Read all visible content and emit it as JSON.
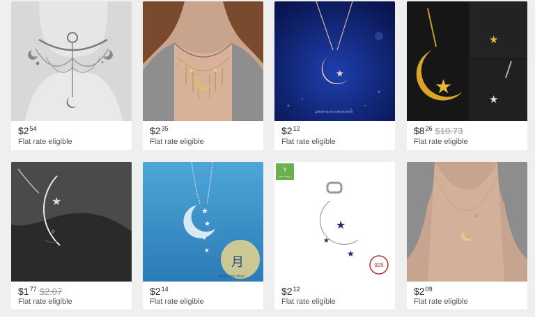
{
  "products": [
    {
      "dollars": "$2",
      "cents": "54",
      "old_price": "",
      "shipping": "Flat rate eligible",
      "image_icon": "choker-moon-necklace"
    },
    {
      "dollars": "$2",
      "cents": "35",
      "old_price": "",
      "shipping": "Flat rate eligible",
      "image_icon": "star-moon-tassel-necklace"
    },
    {
      "dollars": "$2",
      "cents": "12",
      "old_price": "",
      "shipping": "Flat rate eligible",
      "image_icon": "crescent-moon-pendant-blue"
    },
    {
      "dollars": "$8",
      "cents": "26",
      "old_price": "$10.73",
      "shipping": "Flat rate eligible",
      "image_icon": "gold-crescent-star-pendant"
    },
    {
      "dollars": "$1",
      "cents": "77",
      "old_price": "$2.07",
      "shipping": "Flat rate eligible",
      "image_icon": "silver-moon-face-necklace"
    },
    {
      "dollars": "$2",
      "cents": "14",
      "old_price": "",
      "shipping": "Flat rate eligible",
      "image_icon": "moon-stars-necklace-blue"
    },
    {
      "dollars": "$2",
      "cents": "12",
      "old_price": "",
      "shipping": "Flat rate eligible",
      "image_icon": "moon-star-charm-925"
    },
    {
      "dollars": "$2",
      "cents": "09",
      "old_price": "",
      "shipping": "Flat rate eligible",
      "image_icon": "dainty-moon-star-necklace"
    }
  ],
  "image_text": {
    "pendant_caption": "DREAM FALLING STAR AND MOON",
    "stamp": "925",
    "badge": "Silver Charm",
    "brand_script": "Moon Star River"
  },
  "colors": {
    "page_bg": "#efefef",
    "card_bg": "#ffffff",
    "old_price": "#999999"
  }
}
